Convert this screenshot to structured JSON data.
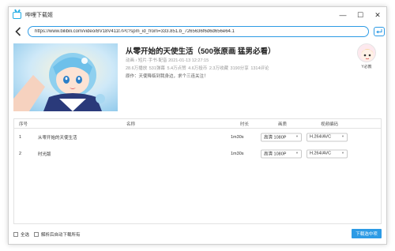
{
  "app": {
    "title": "哔哩下载姬"
  },
  "window_controls": {
    "minimize": "—",
    "maximize": "☐",
    "close": "✕"
  },
  "address": {
    "url": "https://www.bilibili.com/video/BV18V411t7Pc?spm_id_from=333.851.b_7265636f6d6d656e64.1"
  },
  "video": {
    "title": "从零开始的天使生活（500张原画 猛男必看）",
    "meta": "动画 › 短片·手书·配音    2021-01-13 12:27:15",
    "stats": [
      "28.6万播放",
      "531弹幕",
      "5.4万点赞",
      "4.6万投币",
      "2.3万收藏",
      "3190分享",
      "1314评论"
    ],
    "desc": "原作：天使降临到我身边，求个三连关注！"
  },
  "uploader": {
    "name": "Y必教"
  },
  "table": {
    "headers": {
      "index": "序号",
      "name": "名称",
      "duration": "时长",
      "quality": "画质",
      "codec": "视频编码"
    },
    "rows": [
      {
        "index": "1",
        "name": "从零开始的天使生活",
        "duration": "1m30s",
        "quality": "高清 1080P",
        "codec": "H.264/AVC"
      },
      {
        "index": "2",
        "name": "时光版",
        "duration": "1m30s",
        "quality": "高清 1080P",
        "codec": "H.264/AVC"
      }
    ]
  },
  "footer": {
    "select_all": "全选",
    "auto_download": "解析后自动下载所有",
    "download_button": "下载选中项"
  },
  "colors": {
    "accent": "#2d9be5",
    "brand": "#23ade5"
  }
}
